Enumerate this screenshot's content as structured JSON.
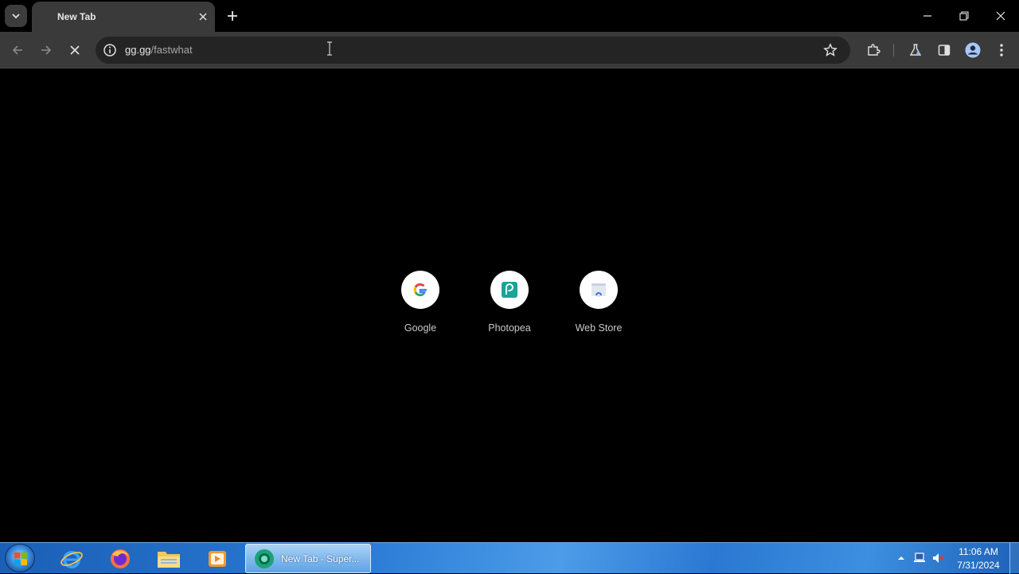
{
  "tab": {
    "title": "New Tab"
  },
  "omnibox": {
    "host": "gg.gg",
    "path": "/fastwhat"
  },
  "shortcuts": [
    {
      "label": "Google",
      "icon": "google-g-icon"
    },
    {
      "label": "Photopea",
      "icon": "photopea-icon"
    },
    {
      "label": "Web Store",
      "icon": "web-store-icon"
    }
  ],
  "taskbar": {
    "active_window": "New Tab - Super...",
    "apps": [
      "internet-explorer-icon",
      "firefox-icon",
      "file-explorer-icon",
      "media-player-icon"
    ],
    "clock_time": "11:06 AM",
    "clock_date": "7/31/2024"
  },
  "colors": {
    "page_background": "#000000",
    "toolbar": "#3a3a3a",
    "omnibox": "#242424",
    "taskbar_accent": "#2a7ad6"
  }
}
